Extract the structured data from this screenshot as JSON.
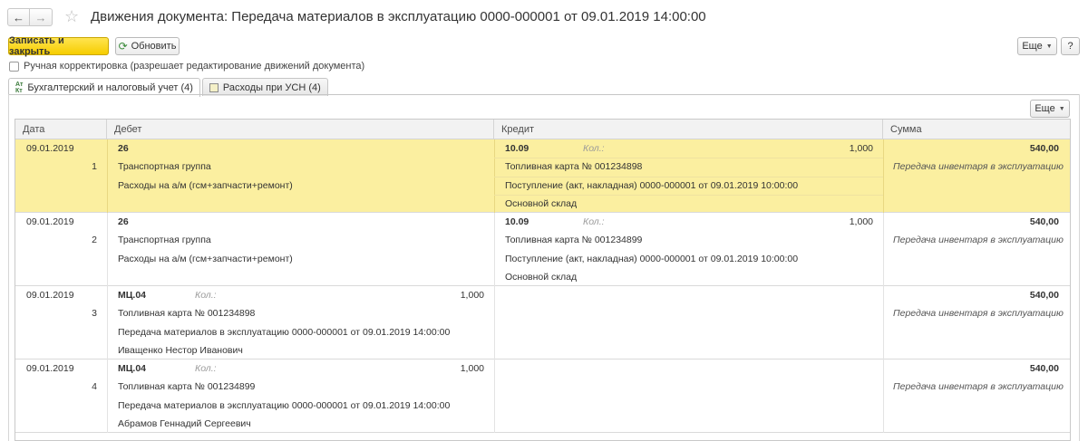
{
  "window": {
    "title": "Движения документа: Передача материалов в эксплуатацию 0000-000001 от 09.01.2019 14:00:00",
    "back_icon": "←",
    "forward_icon": "→",
    "favorite_icon": "☆"
  },
  "toolbar": {
    "save_close_label": "Записать и закрыть",
    "refresh_label": "Обновить",
    "more_label": "Еще",
    "help_label": "?"
  },
  "manual_correction": {
    "label": "Ручная корректировка (разрешает редактирование движений документа)",
    "checked": false
  },
  "tabs": [
    {
      "label": "Бухгалтерский и налоговый учет (4)",
      "icon": "accounting-icon",
      "icon_text": "АтКт",
      "active": true
    },
    {
      "label": "Расходы при УСН (4)",
      "icon": "document-icon",
      "active": false
    }
  ],
  "grid": {
    "more_label": "Еще",
    "columns": {
      "date": "Дата",
      "debit": "Дебет",
      "credit": "Кредит",
      "sum": "Сумма"
    },
    "kol_label": "Кол.:",
    "rows": [
      {
        "date": "09.01.2019",
        "n": "1",
        "debit_account": "26",
        "debit_qty": "",
        "debit_sub": [
          "Транспортная группа",
          "Расходы на а/м (гсм+запчасти+ремонт)",
          ""
        ],
        "credit_account": "10.09",
        "credit_qty": "1,000",
        "credit_sub": [
          "Топливная карта № 001234898",
          "Поступление (акт, накладная) 0000-000001 от 09.01.2019 10:00:00",
          "Основной склад"
        ],
        "sum": "540,00",
        "content": "Передача инвентаря в эксплуатацию",
        "selected": true
      },
      {
        "date": "09.01.2019",
        "n": "2",
        "debit_account": "26",
        "debit_qty": "",
        "debit_sub": [
          "Транспортная группа",
          "Расходы на а/м (гсм+запчасти+ремонт)",
          ""
        ],
        "credit_account": "10.09",
        "credit_qty": "1,000",
        "credit_sub": [
          "Топливная карта № 001234899",
          "Поступление (акт, накладная) 0000-000001 от 09.01.2019 10:00:00",
          "Основной склад"
        ],
        "sum": "540,00",
        "content": "Передача инвентаря в эксплуатацию",
        "selected": false
      },
      {
        "date": "09.01.2019",
        "n": "3",
        "debit_account": "МЦ.04",
        "debit_qty": "1,000",
        "debit_sub": [
          "Топливная карта № 001234898",
          "Передача материалов в эксплуатацию 0000-000001 от 09.01.2019 14:00:00",
          "Иващенко Нестор Иванович"
        ],
        "credit_account": "",
        "credit_qty": "",
        "credit_sub": [
          "",
          "",
          ""
        ],
        "sum": "540,00",
        "content": "Передача инвентаря в эксплуатацию",
        "selected": false
      },
      {
        "date": "09.01.2019",
        "n": "4",
        "debit_account": "МЦ.04",
        "debit_qty": "1,000",
        "debit_sub": [
          "Топливная карта № 001234899",
          "Передача материалов в эксплуатацию 0000-000001 от 09.01.2019 14:00:00",
          "Абрамов Геннадий Сергеевич"
        ],
        "credit_account": "",
        "credit_qty": "",
        "credit_sub": [
          "",
          "",
          ""
        ],
        "sum": "540,00",
        "content": "Передача инвентаря в эксплуатацию",
        "selected": false
      }
    ]
  },
  "colors": {
    "primary_button": "#f6cd00",
    "selected_row": "#fbefa0"
  }
}
